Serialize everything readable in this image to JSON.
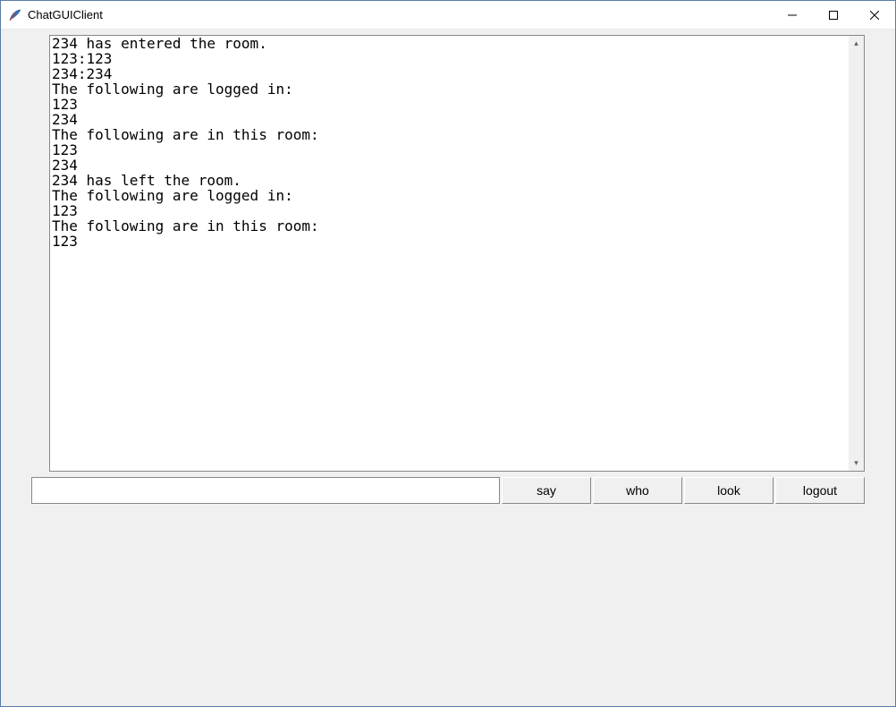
{
  "window": {
    "title": "ChatGUIClient"
  },
  "chat": {
    "log": "234 has entered the room.\n123:123\n234:234\nThe following are logged in:\n123\n234\nThe following are in this room:\n123\n234\n234 has left the room.\nThe following are logged in:\n123\nThe following are in this room:\n123"
  },
  "input": {
    "value": "",
    "placeholder": ""
  },
  "buttons": {
    "say": "say",
    "who": "who",
    "look": "look",
    "logout": "logout"
  }
}
